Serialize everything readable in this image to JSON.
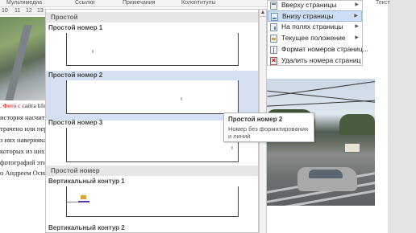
{
  "ribbon": {
    "tabs": [
      "Мультимедиа",
      "Ссылки",
      "Примечания",
      "Колонтитулы"
    ],
    "right_label": "Текст"
  },
  "ruler": {
    "marks": [
      "10",
      "11",
      "12",
      "13"
    ]
  },
  "document_left": {
    "caption_prefix": ". Фото с",
    "caption_rest": " сайта life-p",
    "lines": [
      "история насчитыва",
      "трачено или перес",
      "з них наверняка не",
      "которых из них оч",
      "фотографий этих",
      "о Андреем Осипо"
    ]
  },
  "gallery": {
    "sections": [
      {
        "header": "Простой",
        "items": [
          {
            "title": "Простой номер 1",
            "selected": false
          },
          {
            "title": "Простой номер 2",
            "selected": true
          },
          {
            "title": "Простой номер 3",
            "selected": false
          }
        ]
      },
      {
        "header": "Простой номер",
        "items": [
          {
            "title": "Вертикальный контур 1",
            "selected": false
          },
          {
            "title": "Вертикальный контур 2",
            "selected": false
          }
        ]
      }
    ],
    "scroll_up_glyph": "▲"
  },
  "menu": {
    "items": [
      {
        "label": "Вверху страницы",
        "icon": "page-top-icon",
        "submenu": true,
        "active": false
      },
      {
        "label": "Внизу страницы",
        "icon": "page-bottom-icon",
        "submenu": true,
        "active": true
      },
      {
        "label": "На полях страницы",
        "icon": "page-margin-icon",
        "submenu": true,
        "active": false
      },
      {
        "label": "Текущее положение",
        "icon": "current-position-icon",
        "submenu": true,
        "active": false
      },
      {
        "label": "Формат номеров страниц...",
        "icon": "format-icon",
        "submenu": false,
        "active": false
      },
      {
        "label": "Удалить номера страниц",
        "icon": "delete-icon",
        "submenu": false,
        "active": false
      }
    ],
    "submenu_arrow": "▶"
  },
  "tooltip": {
    "title": "Простой номер 2",
    "description": "Номер без форматирования и линий"
  },
  "colors": {
    "selection": "#d5e1f2",
    "menu_active": "#cfdff3",
    "section_header": "#e6e6e6"
  }
}
